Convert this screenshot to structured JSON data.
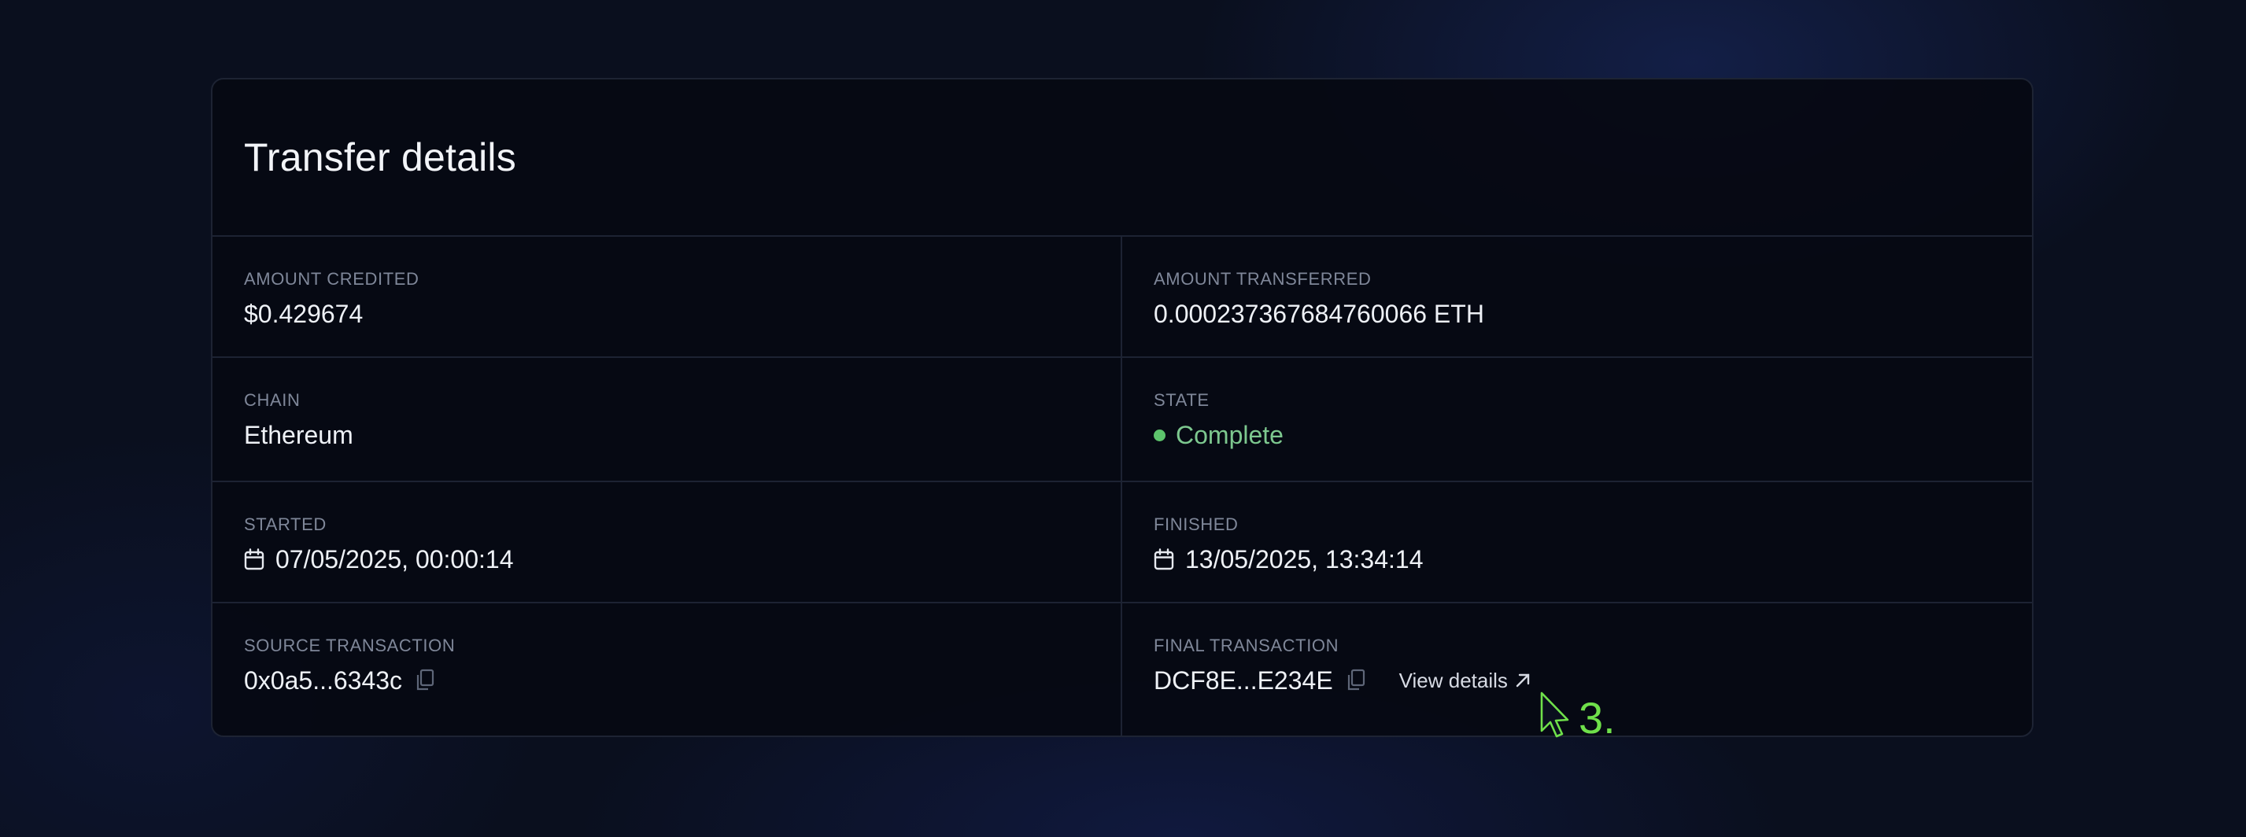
{
  "title": "Transfer details",
  "fields": {
    "amount_credited": {
      "label": "AMOUNT CREDITED",
      "value": "$0.429674"
    },
    "amount_transferred": {
      "label": "AMOUNT TRANSFERRED",
      "value": "0.000237367684760066 ETH"
    },
    "chain": {
      "label": "CHAIN",
      "value": "Ethereum"
    },
    "state": {
      "label": "STATE",
      "value": "Complete",
      "color": "#5dc46c"
    },
    "started": {
      "label": "STARTED",
      "value": "07/05/2025, 00:00:14",
      "icon": "calendar-icon"
    },
    "finished": {
      "label": "FINISHED",
      "value": "13/05/2025, 13:34:14",
      "icon": "calendar-icon"
    },
    "source_transaction": {
      "label": "SOURCE TRANSACTION",
      "value": "0x0a5...6343c",
      "icon": "copy-icon"
    },
    "final_transaction": {
      "label": "FINAL TRANSACTION",
      "value": "DCF8E...E234E",
      "icon": "copy-icon",
      "link_label": "View details",
      "link_icon": "arrow-up-right-icon"
    }
  },
  "annotation": {
    "step_label": "3.",
    "color": "#6fe04a"
  }
}
